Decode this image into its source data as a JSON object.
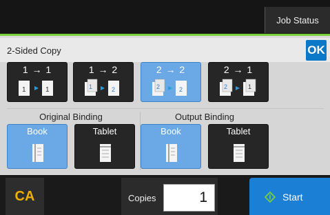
{
  "header": {
    "job_status": "Job Status"
  },
  "screen": {
    "title": "2-Sided Copy",
    "ok": "OK"
  },
  "modes": [
    {
      "label": "1 → 1",
      "selected": false,
      "icon": "single-to-single-icon"
    },
    {
      "label": "1 → 2",
      "selected": false,
      "icon": "single-to-duplex-icon"
    },
    {
      "label": "2 → 2",
      "selected": true,
      "icon": "duplex-to-duplex-icon"
    },
    {
      "label": "2 → 1",
      "selected": false,
      "icon": "duplex-to-single-icon"
    }
  ],
  "original_binding": {
    "title": "Original Binding",
    "options": [
      "Book",
      "Tablet"
    ],
    "selected": "Book"
  },
  "output_binding": {
    "title": "Output Binding",
    "options": [
      "Book",
      "Tablet"
    ],
    "selected": "Book"
  },
  "footer": {
    "ca": "CA",
    "copies_label": "Copies",
    "copies_value": "1",
    "start": "Start"
  },
  "colors": {
    "accent": "#1c7fd6",
    "selected": "#6aa8e6",
    "ca": "#f0b000",
    "status_bar": "#7ad03a"
  }
}
